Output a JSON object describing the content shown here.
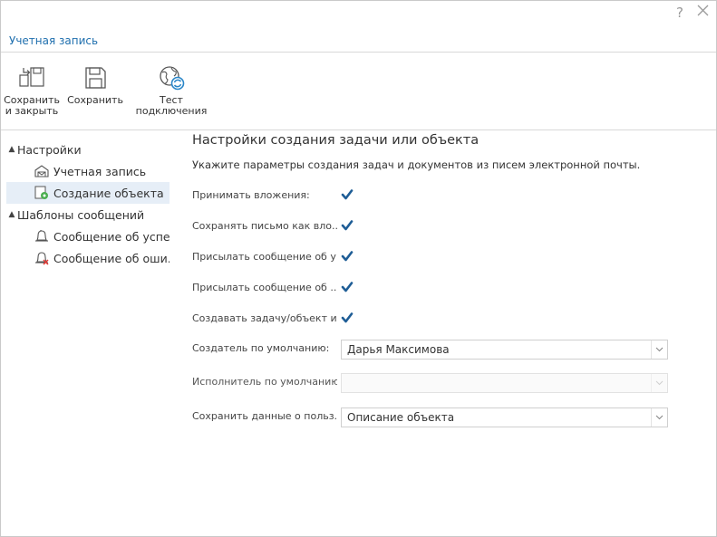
{
  "window": {
    "help_glyph": "?",
    "close_icon": "close-icon"
  },
  "tab": {
    "title": "Учетная запись"
  },
  "toolbar": {
    "save_close_line1": "Сохранить",
    "save_close_line2": "и закрыть",
    "save_label": "Сохранить",
    "test_line1": "Тест",
    "test_line2": "подключения"
  },
  "tree": {
    "settings": "Настройки",
    "account": "Учетная запись",
    "object_creation": "Создание объекта",
    "templates": "Шаблоны сообщений",
    "success_msg": "Сообщение об успе...",
    "error_msg": "Сообщение об оши..."
  },
  "pane": {
    "title": "Настройки создания задачи или объекта",
    "subtitle": "Укажите параметры создания задач и документов из писем электронной почты."
  },
  "fields": {
    "accept_attachments": {
      "label": "Принимать вложения:",
      "checked": true
    },
    "save_letter": {
      "label": "Сохранять письмо как вло...",
      "checked": true
    },
    "send_success": {
      "label": "Присылать сообщение об у...",
      "checked": true
    },
    "send_error": {
      "label": "Присылать сообщение об ...",
      "checked": true
    },
    "create_task": {
      "label": "Создавать задачу/объект и...",
      "checked": true
    },
    "default_creator": {
      "label": "Создатель по умолчанию:",
      "value": "Дарья Максимова"
    },
    "default_executor": {
      "label": "Исполнитель по умолчанию:",
      "value": ""
    },
    "save_user_data": {
      "label": "Сохранить данные о польз...",
      "value": "Описание объекта"
    }
  },
  "colors": {
    "accent": "#1f6fae",
    "check": "#1e5d96",
    "selection": "#e6eef7"
  }
}
